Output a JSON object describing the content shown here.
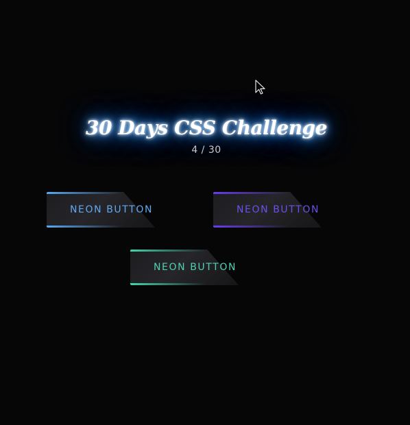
{
  "header": {
    "title": "30 Days CSS Challenge",
    "progress_text": "4 / 30"
  },
  "buttons": [
    {
      "label": "NEON BUTTON",
      "color": "#5aaaf5",
      "color_name": "blue"
    },
    {
      "label": "NEON BUTTON",
      "color": "#6a3df0",
      "color_name": "purple"
    },
    {
      "label": "NEON BUTTON",
      "color": "#44d6ac",
      "color_name": "green"
    }
  ],
  "cursor": {
    "icon": "mouse-pointer-icon"
  },
  "colors": {
    "background": "#060607",
    "title_glow": "#3d8ff0"
  }
}
